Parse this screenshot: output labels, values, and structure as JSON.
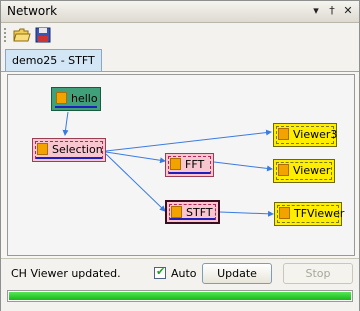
{
  "window": {
    "title": "Network",
    "buttons": {
      "pin": "▾",
      "dock": "†",
      "close": "✕"
    }
  },
  "toolbar": {
    "open_icon": "folder-open-icon",
    "save_icon": "floppy-save-icon"
  },
  "tabs": [
    {
      "label": "demo25 - STFT",
      "active": true
    }
  ],
  "nodes": {
    "hello": "hello",
    "selection": "Selection",
    "fft": "FFT",
    "stft": "STFT",
    "viewer3": "Viewer3",
    "viewer": "Viewer",
    "tfviewer": "TFViewer"
  },
  "colors": {
    "link": "#3a7be0",
    "source_node": "#3fa07a",
    "process_node": "#f8c6cf",
    "viewer_node": "#ffee00",
    "progress": "#22c322"
  },
  "status": {
    "message": "CH Viewer updated.",
    "auto_label": "Auto",
    "auto_checked": true,
    "update_label": "Update",
    "stop_label": "Stop",
    "progress": 1.0
  }
}
